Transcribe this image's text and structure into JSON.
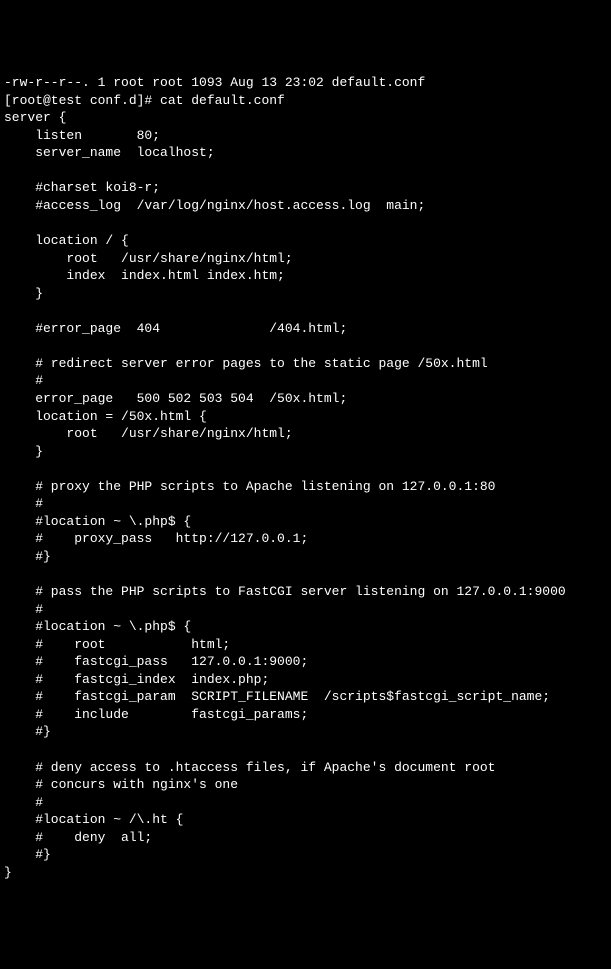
{
  "terminal": {
    "lines": [
      "-rw-r--r--. 1 root root 1093 Aug 13 23:02 default.conf",
      "[root@test conf.d]# cat default.conf",
      "server {",
      "    listen       80;",
      "    server_name  localhost;",
      "",
      "    #charset koi8-r;",
      "    #access_log  /var/log/nginx/host.access.log  main;",
      "",
      "    location / {",
      "        root   /usr/share/nginx/html;",
      "        index  index.html index.htm;",
      "    }",
      "",
      "    #error_page  404              /404.html;",
      "",
      "    # redirect server error pages to the static page /50x.html",
      "    #",
      "    error_page   500 502 503 504  /50x.html;",
      "    location = /50x.html {",
      "        root   /usr/share/nginx/html;",
      "    }",
      "",
      "    # proxy the PHP scripts to Apache listening on 127.0.0.1:80",
      "    #",
      "    #location ~ \\.php$ {",
      "    #    proxy_pass   http://127.0.0.1;",
      "    #}",
      "",
      "    # pass the PHP scripts to FastCGI server listening on 127.0.0.1:9000",
      "    #",
      "    #location ~ \\.php$ {",
      "    #    root           html;",
      "    #    fastcgi_pass   127.0.0.1:9000;",
      "    #    fastcgi_index  index.php;",
      "    #    fastcgi_param  SCRIPT_FILENAME  /scripts$fastcgi_script_name;",
      "    #    include        fastcgi_params;",
      "    #}",
      "",
      "    # deny access to .htaccess files, if Apache's document root",
      "    # concurs with nginx's one",
      "    #",
      "    #location ~ /\\.ht {",
      "    #    deny  all;",
      "    #}",
      "}"
    ]
  }
}
